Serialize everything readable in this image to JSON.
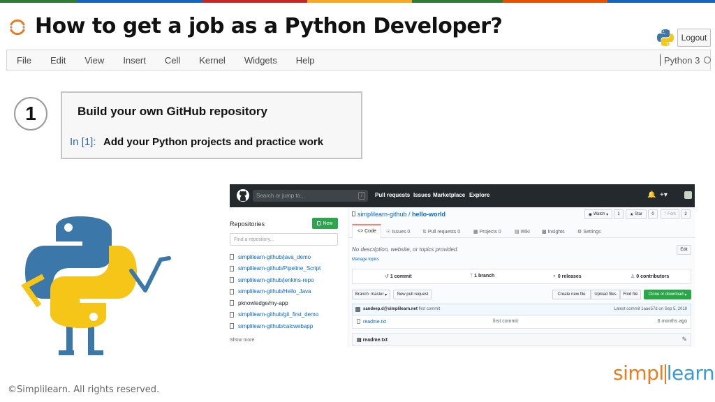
{
  "slide": {
    "title": "How to get a job as a Python Developer?",
    "top_bar_colors": [
      "#2e7d32",
      "#1565c0",
      "#c62828",
      "#f9a825",
      "#2e7d32",
      "#e65100",
      "#1565c0"
    ],
    "accent_color": "#e87c1e"
  },
  "header": {
    "logout_label": "Logout"
  },
  "menubar": {
    "items": [
      "File",
      "Edit",
      "View",
      "Insert",
      "Cell",
      "Kernel",
      "Widgets",
      "Help"
    ],
    "kernel_label": "Python 3"
  },
  "step": {
    "number": "1",
    "heading": "Build your own GitHub repository",
    "prompt": "In [1]:",
    "code": "Add your Python projects and practice work"
  },
  "github": {
    "search_placeholder": "Search or jump to...",
    "search_shortcut": "/",
    "nav": [
      "Pull requests",
      "Issues",
      "Marketplace",
      "Explore"
    ],
    "repositories_title": "Repositories",
    "new_button": "New",
    "find_placeholder": "Find a repository...",
    "repos": [
      "simplilearn-github/java_demo",
      "simplilearn-github/Pipeline_Script",
      "simplilearn-github/jenkins-repo",
      "simplilearn-github/Hello_Java",
      "pknowledge/my-app",
      "simplilearn-github/git_first_demo",
      "simplilearn-github/calcwebapp"
    ],
    "show_more": "Show more",
    "repo_owner": "simplilearn-github",
    "repo_sep": " / ",
    "repo_name": "hello-world",
    "watch_label": "Watch",
    "watch_count": "1",
    "star_label": "Star",
    "star_count": "0",
    "fork_label": "Fork",
    "fork_count": "2",
    "tabs": [
      "Code",
      "Issues 0",
      "Pull requests 0",
      "Projects 0",
      "Wiki",
      "Insights",
      "Settings"
    ],
    "description": "No description, website, or topics provided.",
    "manage_topics": "Manage topics",
    "edit_label": "Edit",
    "stats": [
      "1 commit",
      "1 branch",
      "0 releases",
      "0 contributors"
    ],
    "branch_label": "Branch: master",
    "new_pr_label": "New pull request",
    "file_buttons": [
      "Create new file",
      "Upload files",
      "Find file"
    ],
    "clone_label": "Clone or download",
    "commit_author": "sandeep.d@simplilearn.net",
    "commit_message": "first commit",
    "commit_latest": "Latest commit 1aae57d on Sep 5, 2018",
    "file_name": "readme.txt",
    "file_message": "first commit",
    "file_age": "6 months ago",
    "readme_label": "readme.txt"
  },
  "footer": {
    "copyright": "©Simplilearn. All rights reserved.",
    "brand_part1": "simpl",
    "brand_part2": "learn"
  },
  "icons": {
    "title_icon": "spinner-arc-icon",
    "python_logo": "python-logo-icon",
    "github_logo": "github-octocat-icon",
    "python_character": "python-mascot-illustration"
  }
}
